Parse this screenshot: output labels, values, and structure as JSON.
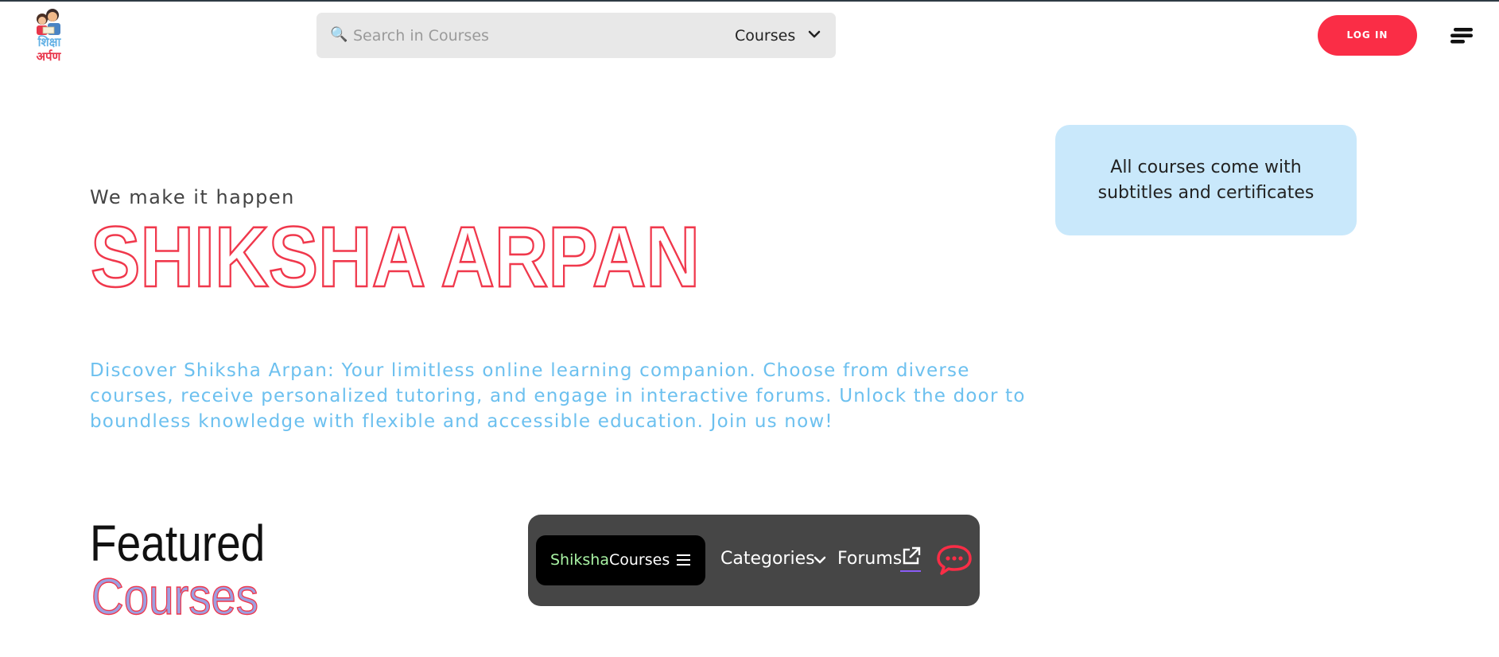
{
  "header": {
    "logo": {
      "line1": "शिक्षा",
      "line2": "अर्पण",
      "icon": "kids-reading-logo"
    },
    "search": {
      "placeholder": "Search in Courses",
      "value": "",
      "scope_selected": "Courses",
      "icon": "search-icon"
    },
    "login_label": "LOG IN",
    "menu_icon": "menu-icon"
  },
  "hero": {
    "tagline": "We make it happen",
    "brand_title": "SHIKSHA ARPAN",
    "info_bubble": "All courses come with subtitles and certificates",
    "description": "Discover Shiksha Arpan: Your limitless online learning companion. Choose from diverse courses, receive personalized tutoring, and engage in interactive forums. Unlock the door to boundless knowledge with flexible and accessible education. Join us now!"
  },
  "featured": {
    "line1": "Featured",
    "line2": "Courses"
  },
  "navbar": {
    "pill_brand": "Shiksha",
    "pill_label": "Courses",
    "categories_label": "Categories",
    "forums_label": "Forums"
  },
  "colors": {
    "accent_red": "#fa2d46",
    "light_blue": "#6cc0ef",
    "bubble_bg": "#c9e8fb",
    "navbar_bg": "#464646",
    "pill_green": "#a9f3a4"
  }
}
